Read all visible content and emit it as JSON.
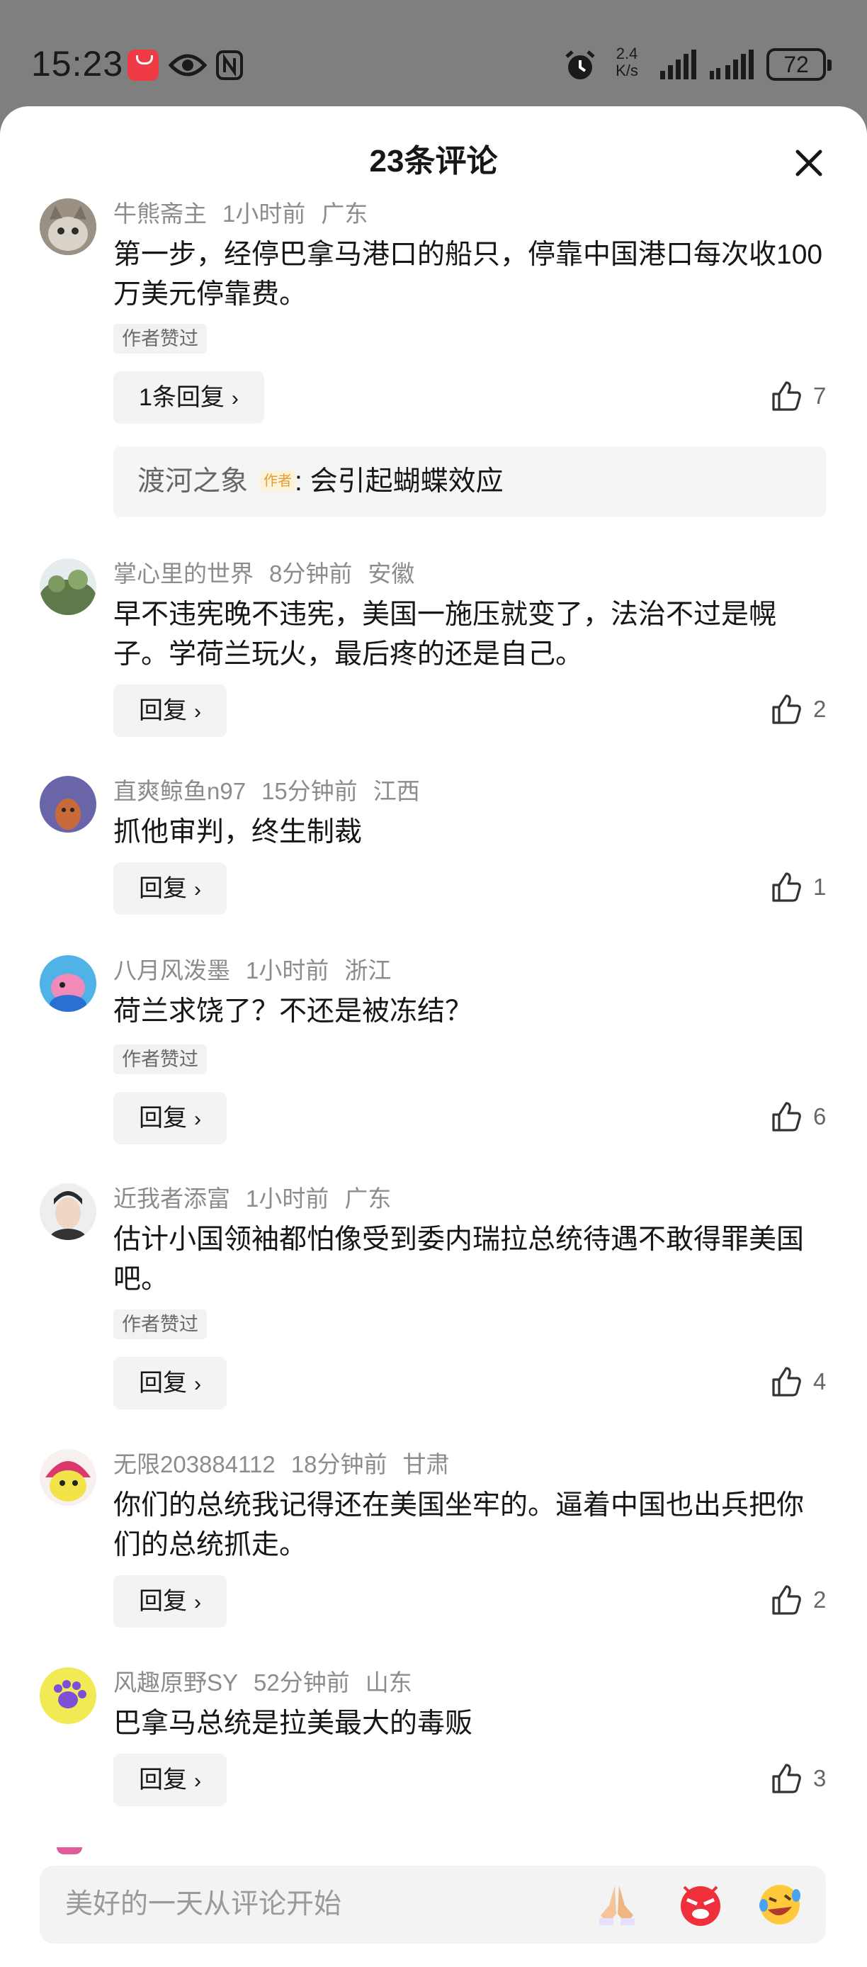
{
  "status_bar": {
    "time": "15:23",
    "net_speed_value": "2.4",
    "net_speed_unit": "K/s",
    "battery": "72",
    "icons": [
      "huawei-app-icon",
      "eye-icon",
      "nfc-icon",
      "alarm-icon",
      "signal-icon",
      "signal-icon",
      "battery-icon"
    ]
  },
  "sheet": {
    "title": "23条评论",
    "close_icon": "close-icon"
  },
  "comments": [
    {
      "user": "牛熊斋主",
      "time": "1小时前",
      "region": "广东",
      "text": "第一步，经停巴拿马港口的船只，停靠中国港口每次收100万美元停靠费。",
      "author_liked": "作者赞过",
      "reply_label": "1条回复",
      "likes": "7",
      "sub_reply": {
        "user": "渡河之象",
        "tag": "作者",
        "text": ": 会引起蝴蝶效应"
      }
    },
    {
      "user": "掌心里的世界",
      "time": "8分钟前",
      "region": "安徽",
      "text": "早不违宪晚不违宪，美国一施压就变了，法治不过是幌子。学荷兰玩火，最后疼的还是自己。",
      "reply_label": "回复",
      "likes": "2"
    },
    {
      "user": "直爽鲸鱼n97",
      "time": "15分钟前",
      "region": "江西",
      "text": "抓他审判，终生制裁",
      "reply_label": "回复",
      "likes": "1"
    },
    {
      "user": "八月风泼墨",
      "time": "1小时前",
      "region": "浙江",
      "text": "荷兰求饶了？不还是被冻结？",
      "author_liked": "作者赞过",
      "reply_label": "回复",
      "likes": "6"
    },
    {
      "user": "近我者添富",
      "time": "1小时前",
      "region": "广东",
      "text": "估计小国领袖都怕像受到委内瑞拉总统待遇不敢得罪美国吧。",
      "author_liked": "作者赞过",
      "reply_label": "回复",
      "likes": "4"
    },
    {
      "user": "无限203884112",
      "time": "18分钟前",
      "region": "甘肃",
      "text": "你们的总统我记得还在美国坐牢的。逼着中国也出兵把你们的总统抓走。",
      "reply_label": "回复",
      "likes": "2"
    },
    {
      "user": "风趣原野SY",
      "time": "52分钟前",
      "region": "山东",
      "text": "巴拿马总统是拉美最大的毒贩",
      "reply_label": "回复",
      "likes": "3"
    }
  ],
  "input": {
    "placeholder": "美好的一天从评论开始",
    "emojis": [
      "folded-hands-emoji",
      "angry-face-emoji",
      "laughing-tears-emoji"
    ]
  },
  "colors": {
    "accent_tag": "#e0a030",
    "text": "#161616",
    "meta": "#8c8c8c"
  }
}
